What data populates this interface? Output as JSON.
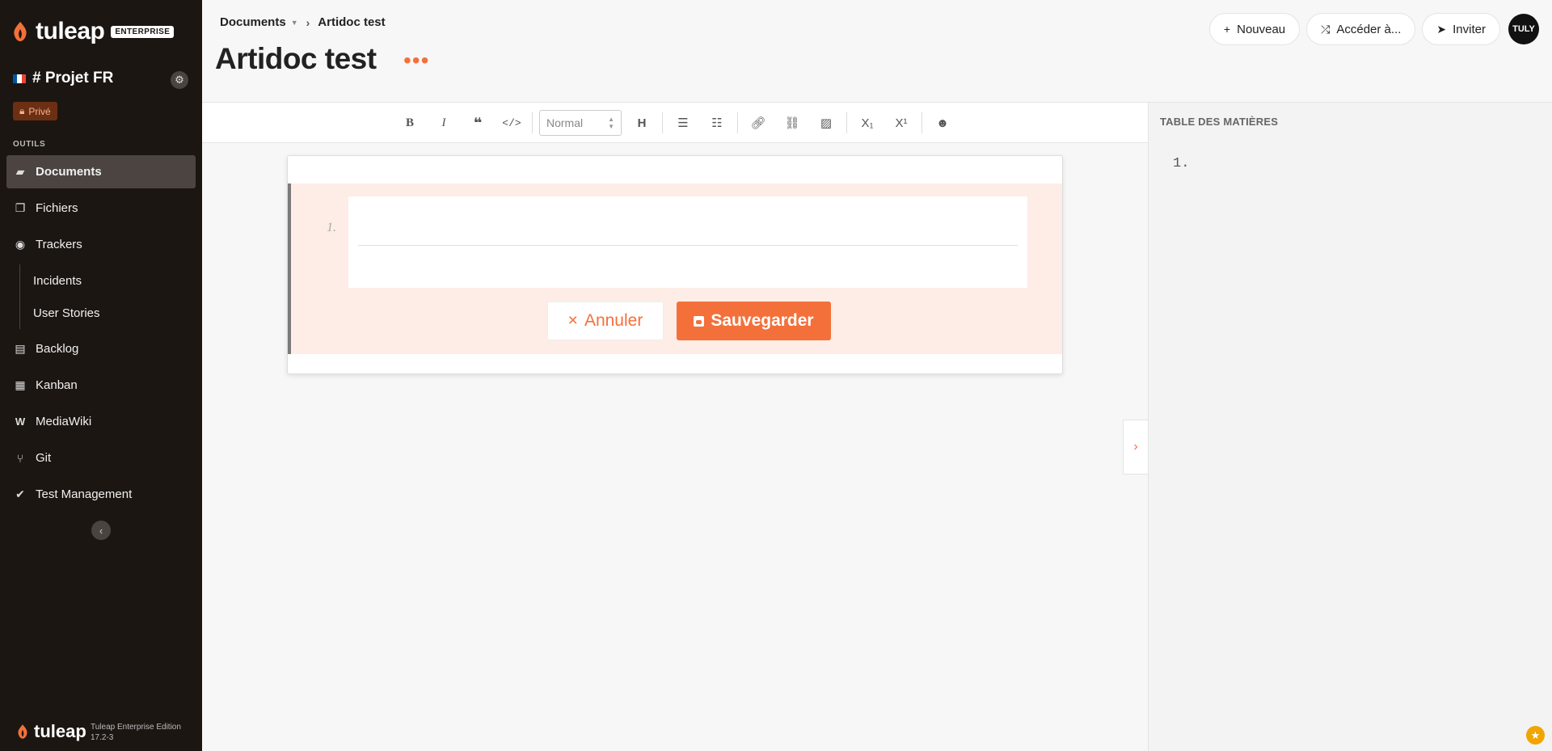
{
  "brand": {
    "name": "tuleap",
    "edition_badge": "ENTERPRISE",
    "accent_color": "#f4703a",
    "sidebar_bg": "#1c1612"
  },
  "project": {
    "name": "# Projet FR",
    "privacy": "Privé"
  },
  "sidebar": {
    "section_label": "OUTILS",
    "items": [
      {
        "label": "Documents",
        "icon": "folder-open-icon",
        "active": true
      },
      {
        "label": "Fichiers",
        "icon": "files-icon"
      },
      {
        "label": "Trackers",
        "icon": "trackers-icon"
      },
      {
        "label": "Incidents",
        "sub": true
      },
      {
        "label": "User Stories",
        "sub": true
      },
      {
        "label": "Backlog",
        "icon": "backlog-icon"
      },
      {
        "label": "Kanban",
        "icon": "kanban-icon"
      },
      {
        "label": "MediaWiki",
        "icon": "mediawiki-icon"
      },
      {
        "label": "Git",
        "icon": "git-branch-icon"
      },
      {
        "label": "Test Management",
        "icon": "check-double-icon"
      }
    ],
    "footer_name": "tuleap",
    "footer_edition": "Tuleap Enterprise Edition",
    "footer_version": "17.2-3"
  },
  "header": {
    "breadcrumb_root": "Documents",
    "breadcrumb_current": "Artidoc test",
    "title": "Artidoc test"
  },
  "actions": {
    "new": "Nouveau",
    "switch_to": "Accéder à...",
    "invite": "Inviter",
    "avatar": "TULY"
  },
  "toolbar": {
    "format_select": "Normal"
  },
  "section": {
    "number": "1.",
    "cancel": "Annuler",
    "save": "Sauvegarder"
  },
  "toc": {
    "title": "TABLE DES MATIÈRES",
    "item": "1."
  }
}
